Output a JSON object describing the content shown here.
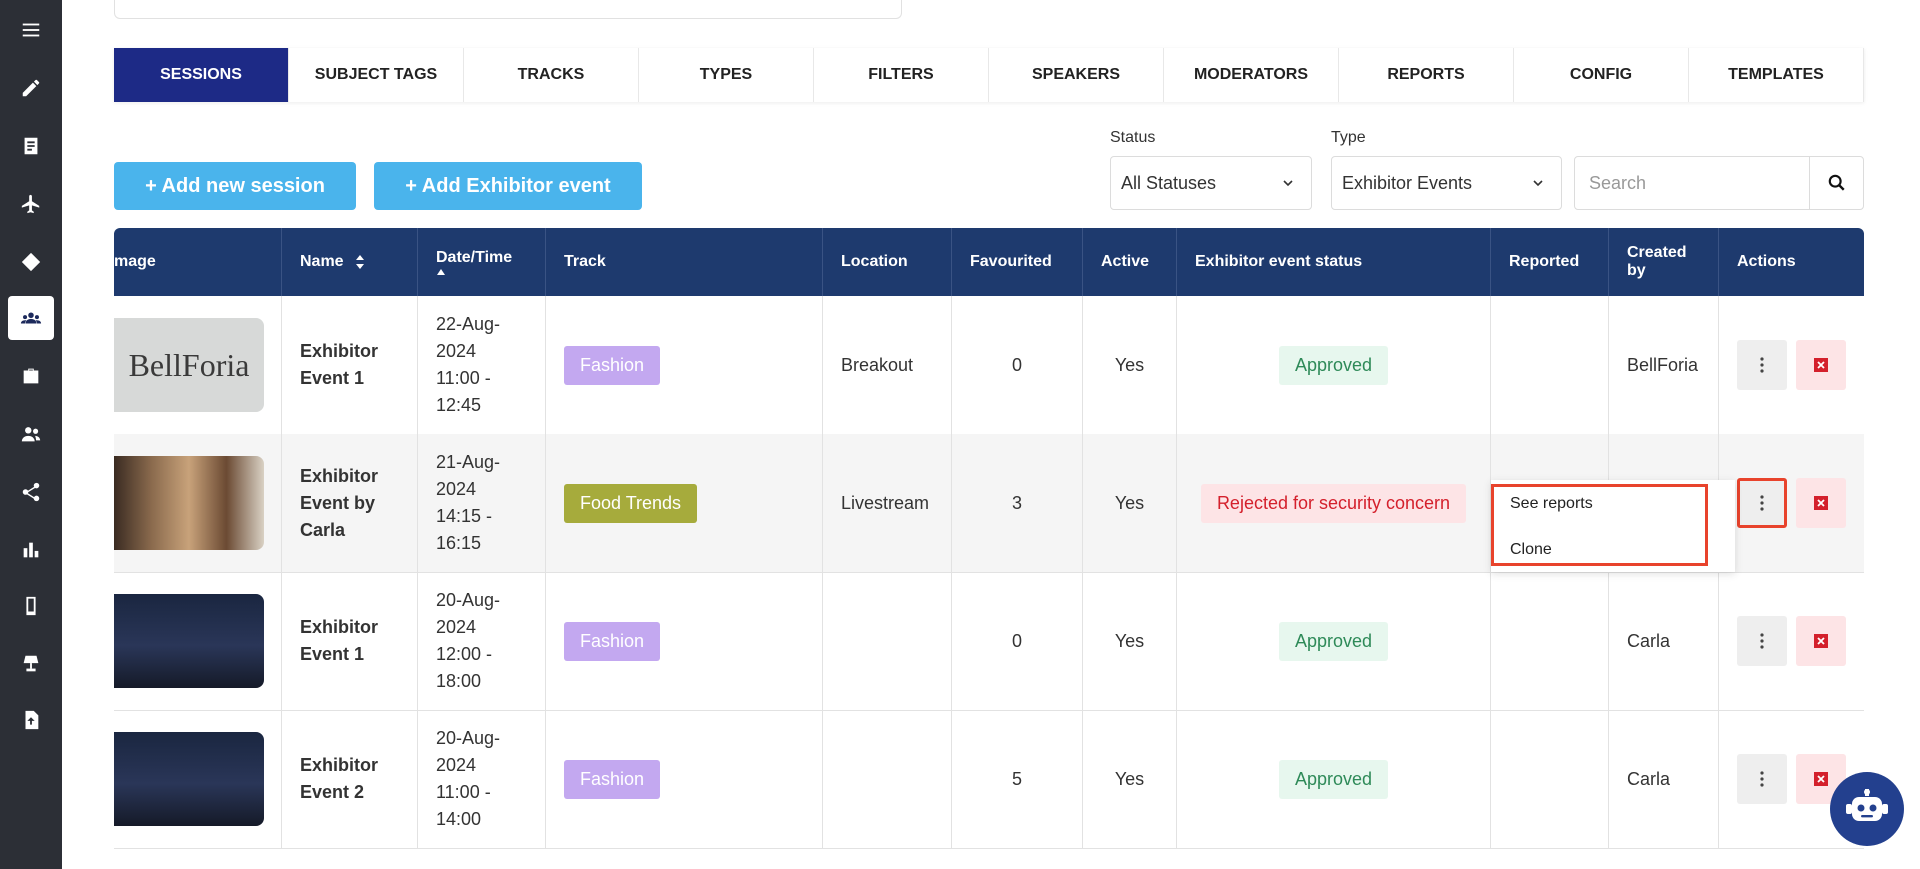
{
  "sidebar": {
    "items": [
      {
        "icon": "menu-icon"
      },
      {
        "icon": "pencil-icon"
      },
      {
        "icon": "document-icon"
      },
      {
        "icon": "airplane-icon"
      },
      {
        "icon": "tag-icon"
      },
      {
        "icon": "sessions-group-icon",
        "active": true
      },
      {
        "icon": "briefcase-icon"
      },
      {
        "icon": "people-icon"
      },
      {
        "icon": "share-icon"
      },
      {
        "icon": "bar-chart-icon"
      },
      {
        "icon": "mobile-icon"
      },
      {
        "icon": "lamp-icon"
      },
      {
        "icon": "upload-file-icon"
      }
    ]
  },
  "tabs": [
    "SESSIONS",
    "SUBJECT TAGS",
    "TRACKS",
    "TYPES",
    "FILTERS",
    "SPEAKERS",
    "MODERATORS",
    "REPORTS",
    "CONFIG",
    "TEMPLATES"
  ],
  "active_tab": "SESSIONS",
  "buttons": {
    "add_session": "+  Add new session",
    "add_exhibitor": "+  Add Exhibitor event"
  },
  "filters": {
    "status_label": "Status",
    "status_value": "All Statuses",
    "type_label": "Type",
    "type_value": "Exhibitor Events",
    "search_placeholder": "Search"
  },
  "table": {
    "headers": {
      "image": "mage",
      "name": "Name",
      "datetime": "Date/Time",
      "track": "Track",
      "location": "Location",
      "favourited": "Favourited",
      "active": "Active",
      "exhibitor_status": "Exhibitor event status",
      "reported": "Reported",
      "created_by": "Created by",
      "actions": "Actions"
    },
    "rows": [
      {
        "name": "Exhibitor Event 1",
        "date": "22-Aug-2024",
        "time": "11:00 - 12:45",
        "track": "Fashion",
        "track_color": "#c3a8f0",
        "location": "Breakout",
        "favourited": "0",
        "active": "Yes",
        "status": "Approved",
        "status_type": "ok",
        "reported": "",
        "created_by": "BellForia",
        "thumb_text": "BellForia"
      },
      {
        "name": "Exhibitor Event by Carla",
        "date": "21-Aug-2024",
        "time": "14:15 - 16:15",
        "track": "Food Trends",
        "track_color": "#a6ab3c",
        "location": "Livestream",
        "favourited": "3",
        "active": "Yes",
        "status": "Rejected for security concern",
        "status_type": "bad",
        "reported": "",
        "created_by": "",
        "thumb_text": ""
      },
      {
        "name": "Exhibitor Event 1",
        "date": "20-Aug-2024",
        "time": "12:00 - 18:00",
        "track": "Fashion",
        "track_color": "#c3a8f0",
        "location": "",
        "favourited": "0",
        "active": "Yes",
        "status": "Approved",
        "status_type": "ok",
        "reported": "",
        "created_by": "Carla",
        "thumb_text": ""
      },
      {
        "name": "Exhibitor Event 2",
        "date": "20-Aug-2024",
        "time": "11:00 - 14:00",
        "track": "Fashion",
        "track_color": "#c3a8f0",
        "location": "",
        "favourited": "5",
        "active": "Yes",
        "status": "Approved",
        "status_type": "ok",
        "reported": "",
        "created_by": "Carla",
        "thumb_text": ""
      }
    ]
  },
  "context_menu": {
    "items": [
      "See reports",
      "Clone"
    ]
  },
  "colors": {
    "sidebar": "#2c2f36",
    "tab_active": "#1d2a86",
    "header": "#1e3a6e",
    "button": "#4ab4ec",
    "highlight": "#e8432c"
  }
}
